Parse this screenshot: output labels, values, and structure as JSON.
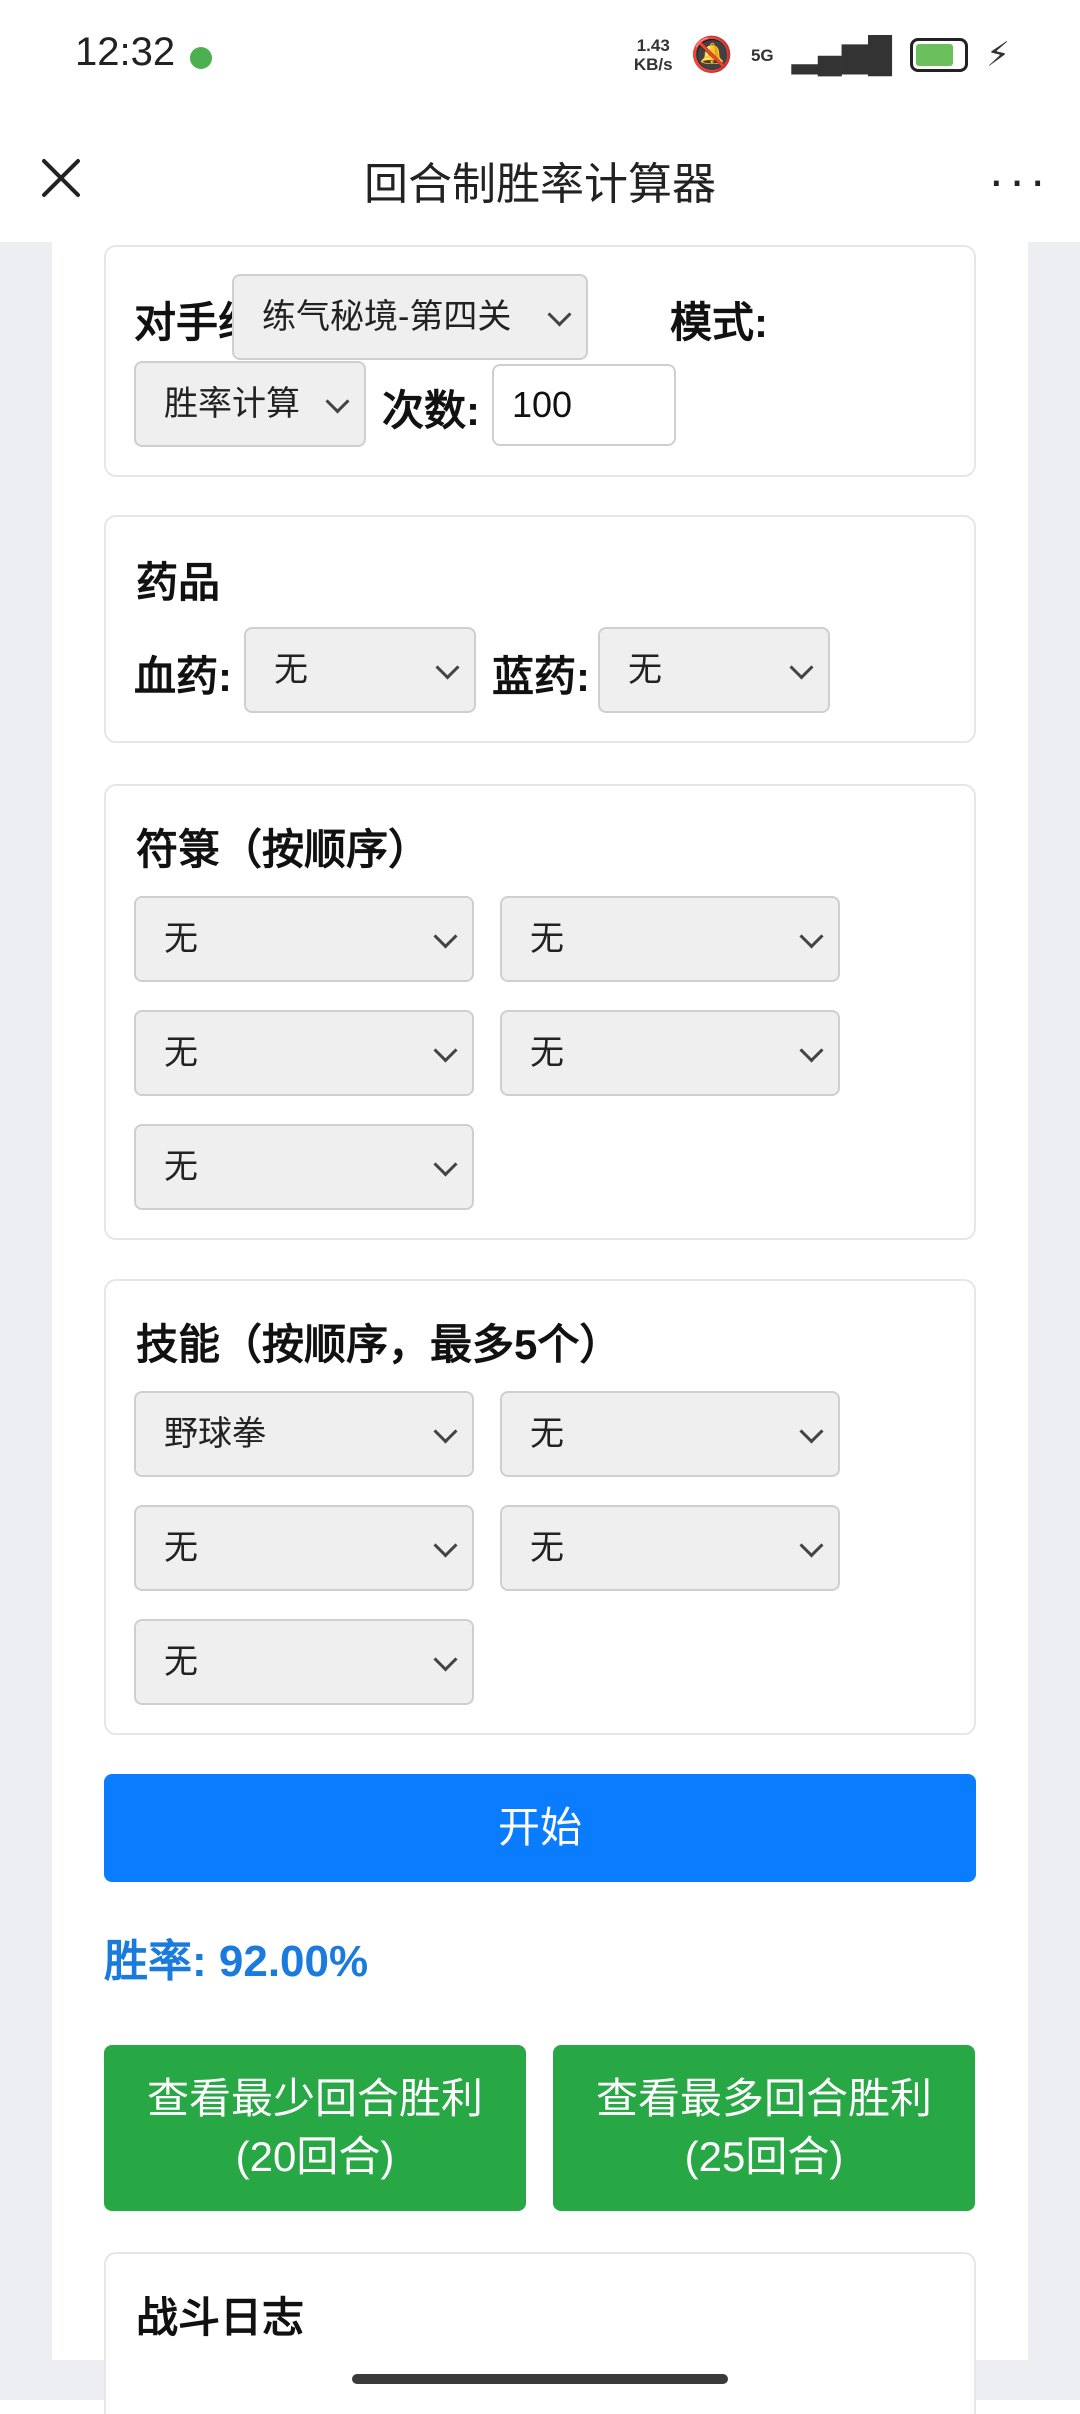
{
  "status_bar": {
    "time": "12:32",
    "net_speed_value": "1.43",
    "net_speed_unit": "KB/s",
    "network": "5G"
  },
  "header": {
    "title": "回合制胜率计算器",
    "more_glyph": "···"
  },
  "settings": {
    "opponent_label": "对手组:",
    "opponent_value": "练气秘境-第四关",
    "mode_label": "模式:",
    "mode_value": "胜率计算",
    "count_label": "次数:",
    "count_value": "100"
  },
  "potions": {
    "title": "药品",
    "hp_label": "血药:",
    "hp_value": "无",
    "mp_label": "蓝药:",
    "mp_value": "无"
  },
  "talismans": {
    "title": "符箓（按顺序）",
    "slots": [
      "无",
      "无",
      "无",
      "无",
      "无"
    ]
  },
  "skills": {
    "title": "技能（按顺序，最多5个）",
    "slots": [
      "野球拳",
      "无",
      "无",
      "无",
      "无"
    ]
  },
  "start_label": "开始",
  "result": {
    "win_rate": "胜率: 92.00%"
  },
  "actions": {
    "min_rounds_label": "查看最少回合胜利 (20回合)",
    "max_rounds_label": "查看最多回合胜利 (25回合)"
  },
  "battle_log": {
    "title": "战斗日志"
  }
}
